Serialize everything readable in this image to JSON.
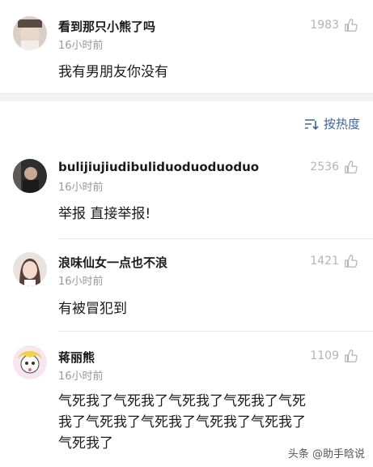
{
  "comments": [
    {
      "name": "看到那只小熊了吗",
      "time": "16小时前",
      "likes": "1983",
      "text": "我有男朋友你没有"
    },
    {
      "name": "bulijiujiudibuliduoduoduoduo",
      "time": "16小时前",
      "likes": "2536",
      "text": "举报 直接举报!"
    },
    {
      "name": "浪味仙女一点也不浪",
      "time": "16小时前",
      "likes": "1421",
      "text": "有被冒犯到"
    },
    {
      "name": "蒋丽熊",
      "time": "16小时前",
      "likes": "1109",
      "text_lines": [
        "气死我了气死我了气死我了气死我了气死",
        "我了气死我了气死我了气死我了气死我了",
        "气死我了"
      ]
    }
  ],
  "sort": {
    "label": "按热度",
    "icon": "sort-icon"
  },
  "watermark": "头条 @助手晗说",
  "colors": {
    "accent": "#406599",
    "muted": "#9a9a9a",
    "like": "#b4b4b4"
  }
}
